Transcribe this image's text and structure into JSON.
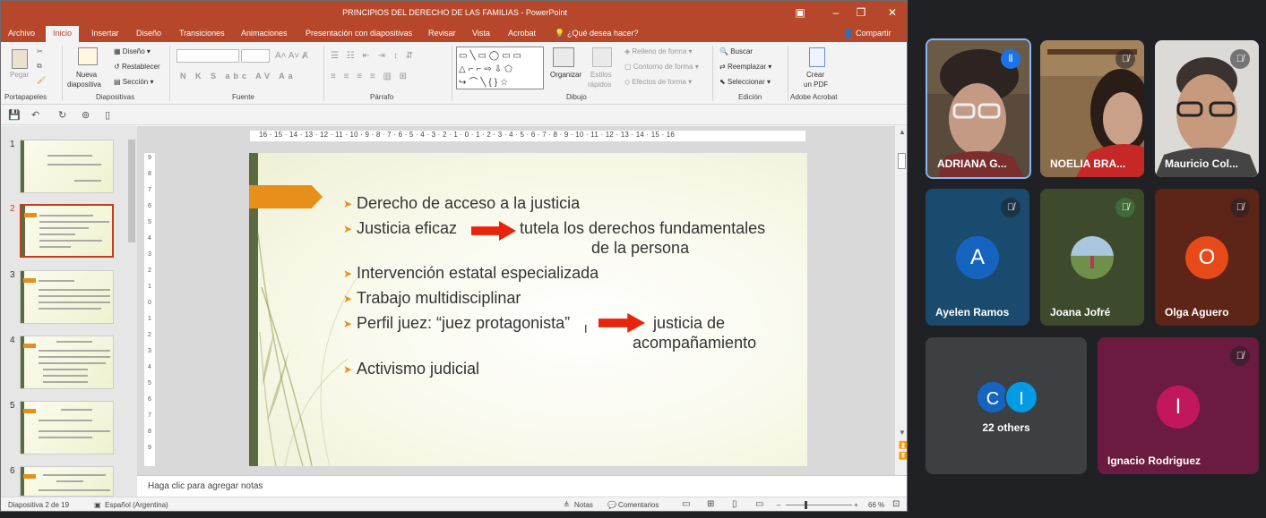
{
  "ppt": {
    "window_title": "PRINCIPIOS DEL DERECHO DE LAS FAMILIAS - PowerPoint",
    "tabs": [
      "Archivo",
      "Inicio",
      "Insertar",
      "Diseño",
      "Transiciones",
      "Animaciones",
      "Presentación con diapositivas",
      "Revisar",
      "Vista",
      "Acrobat"
    ],
    "tell_me": "¿Qué desea hacer?",
    "share": "Compartir",
    "ribbon": {
      "pegar": "Pegar",
      "portapapeles": "Portapapeles",
      "nueva": "Nueva",
      "diapositiva": "diapositiva",
      "diseno": "Diseño",
      "restablecer": "Restablecer",
      "seccion": "Sección",
      "diapositivas": "Diapositivas",
      "fuente": "Fuente",
      "parrafo": "Párrafo",
      "organizar": "Organizar",
      "estilos": "Estilos",
      "rapidos": "rápidos",
      "relleno": "Relleno de forma",
      "contorno": "Contorno de forma",
      "efectos": "Efectos de forma",
      "dibujo": "Dibujo",
      "buscar": "Buscar",
      "reemplazar": "Reemplazar",
      "seleccionar": "Seleccionar",
      "edicion": "Edición",
      "crear": "Crear",
      "unpdf": "un PDF",
      "adobe": "Adobe Acrobat"
    },
    "ruler_text": "16 · 15 · 14 · 13 · 12 · 11 · 10 · 9 · 8 · 7 · 6 · 5 · 4 · 3 · 2 · 1 · 0 · 1 · 2 · 3 · 4 · 5 · 6 · 7 · 8 · 9 · 10 · 11 · 12 · 13 · 14 · 15 · 16",
    "vruler_numbers": [
      "9",
      "8",
      "7",
      "6",
      "5",
      "4",
      "3",
      "2",
      "1",
      "0",
      "1",
      "2",
      "3",
      "4",
      "5",
      "6",
      "7",
      "8",
      "9"
    ],
    "thumbnails": [
      {
        "num": "1",
        "selected": false
      },
      {
        "num": "2",
        "selected": true
      },
      {
        "num": "3",
        "selected": false
      },
      {
        "num": "4",
        "selected": false
      },
      {
        "num": "5",
        "selected": false
      },
      {
        "num": "6",
        "selected": false
      }
    ],
    "slide": {
      "line1": "Derecho de acceso a la justicia",
      "line2a": "Justicia eficaz",
      "line2b": "tutela los derechos fundamentales",
      "line2c": "de la  persona",
      "line3": "Intervención estatal especializada",
      "line4": "Trabajo multidisciplinar",
      "line5a": "Perfil juez: “juez protagonista”",
      "line5b": "justicia de",
      "line5c": "acompañamiento",
      "line6": "Activismo judicial"
    },
    "notes_placeholder": "Haga clic para agregar notas",
    "status": {
      "slide_info": "Diapositiva 2 de 19",
      "language": "Español (Argentina)",
      "notas": "Notas",
      "comentarios": "Comentarios",
      "zoom": "66 %"
    }
  },
  "meet": {
    "participants": [
      {
        "name": "ADRIANA G...",
        "speaking": true
      },
      {
        "name": "NOELIA BRA...",
        "muted": true
      },
      {
        "name": "Mauricio Col...",
        "muted": true
      },
      {
        "name": "Ayelen Ramos",
        "initial": "A",
        "color": "#1565c0",
        "muted": true
      },
      {
        "name": "Joana Jofré",
        "muted": true
      },
      {
        "name": "Olga Aguero",
        "initial": "O",
        "color": "#e64a19",
        "muted": true
      },
      {
        "name": "Ignacio Rodriguez",
        "initial": "I",
        "color": "#c2185b",
        "muted": true
      }
    ],
    "others": {
      "label": "22 others",
      "initial1": "C",
      "initial2": "I"
    }
  }
}
